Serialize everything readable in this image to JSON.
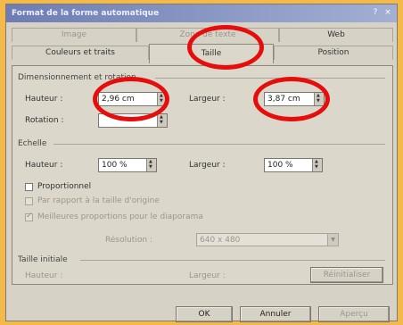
{
  "window": {
    "title": "Format de la forme automatique",
    "help_label": "?",
    "close_label": "×"
  },
  "tabs": {
    "image": "Image",
    "zone_texte": "Zone de texte",
    "web": "Web",
    "couleurs": "Couleurs et traits",
    "taille": "Taille",
    "position": "Position"
  },
  "dimensionnement": {
    "label": "Dimensionnement et rotation",
    "hauteur_label": "Hauteur :",
    "hauteur_value": "2,96 cm",
    "largeur_label": "Largeur :",
    "largeur_value": "3,87 cm",
    "rotation_label": "Rotation :",
    "rotation_value": ""
  },
  "echelle": {
    "label": "Echelle",
    "hauteur_label": "Hauteur :",
    "hauteur_value": "100 %",
    "largeur_label": "Largeur :",
    "largeur_value": "100 %",
    "proportionnel_label": "Proportionnel",
    "par_rapport_label": "Par rapport à la taille d'origine",
    "meilleures_label": "Meilleures proportions pour le diaporama",
    "resolution_label": "Résolution :",
    "resolution_value": "640 x 480"
  },
  "taille_initiale": {
    "label": "Taille initiale",
    "hauteur_label": "Hauteur :",
    "largeur_label": "Largeur :",
    "reinitialiser_label": "Réinitialiser"
  },
  "buttons": {
    "ok": "OK",
    "annuler": "Annuler",
    "apercu": "Aperçu"
  },
  "colors": {
    "annotation": "#e60d0d",
    "background": "#f3b94a"
  }
}
